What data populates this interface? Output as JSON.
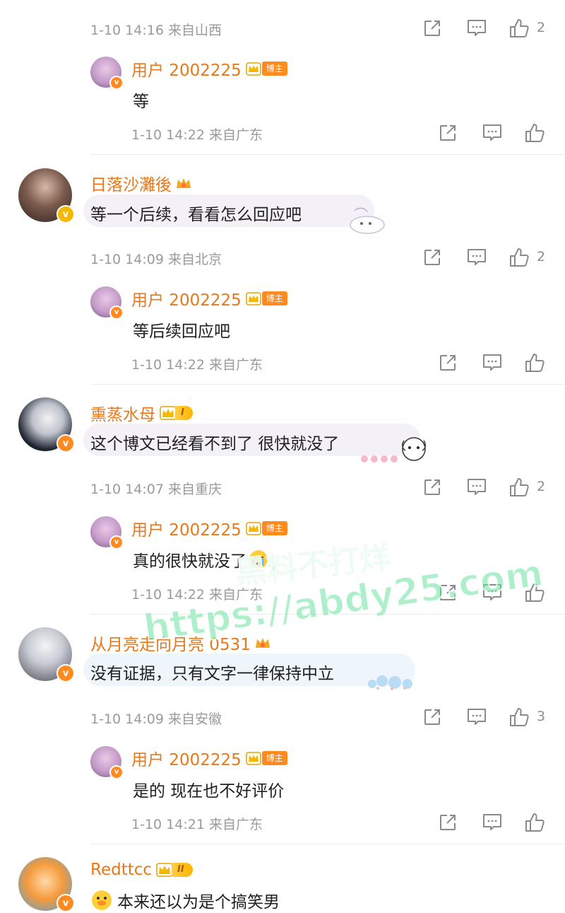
{
  "comments": [
    {
      "meta": "1-10 14:16 来自山西",
      "like_count": "2",
      "reply": {
        "user": "用户 2002225",
        "tag": "博主",
        "text": "等",
        "meta": "1-10 14:22 来自广东"
      }
    },
    {
      "user": "日落沙灘後",
      "text": "等一个后续，看看怎么回应吧",
      "meta": "1-10 14:09 来自北京",
      "like_count": "2",
      "reply": {
        "user": "用户 2002225",
        "tag": "博主",
        "text": "等后续回应吧",
        "meta": "1-10 14:22 来自广东"
      }
    },
    {
      "user": "熏蒸水母",
      "level": "I",
      "text": "这个博文已经看不到了 很快就没了",
      "meta": "1-10 14:07 来自重庆",
      "like_count": "2",
      "reply": {
        "user": "用户 2002225",
        "tag": "博主",
        "text": "真的很快就没了",
        "meta": "1-10 14:22 来自广东"
      }
    },
    {
      "user": "从月亮走向月亮 0531",
      "text": "没有证据，只有文字一律保持中立",
      "meta": "1-10 14:09 来自安徽",
      "like_count": "3",
      "reply": {
        "user": "用户 2002225",
        "tag": "博主",
        "text": "是的 现在也不好评价",
        "meta": "1-10 14:21 来自广东"
      }
    },
    {
      "user": "Redttcc",
      "level": "II",
      "text": "本来还以为是个搞笑男"
    }
  ],
  "watermark": {
    "line1": "黑料不打烊",
    "line2": "https://abdy25.com"
  },
  "colors": {
    "username": "#e8781a",
    "meta": "#9a9a9a",
    "verified": "#ff8a1f",
    "gold": "#f5b800"
  },
  "icons": [
    "share-icon",
    "comment-icon",
    "like-icon",
    "crown-icon",
    "verified-badge"
  ]
}
